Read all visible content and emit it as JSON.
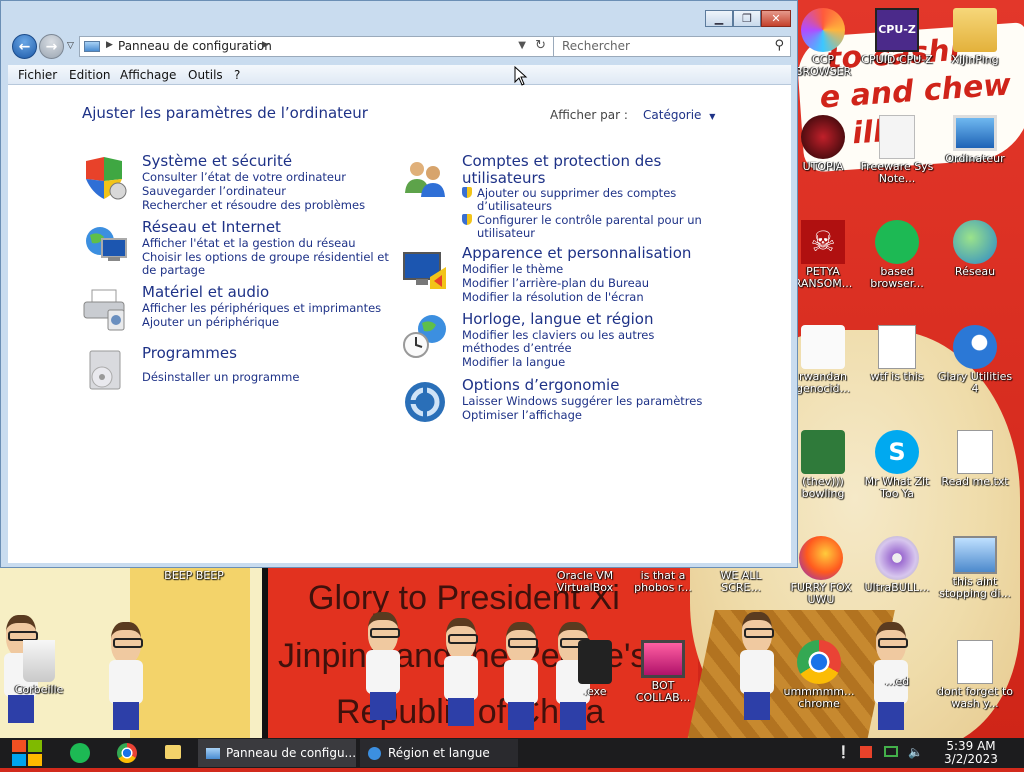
{
  "window": {
    "address_path": "Panneau de configuration",
    "search_placeholder": "Rechercher",
    "menu": [
      "Fichier",
      "Edition",
      "Affichage",
      "Outils",
      "?"
    ],
    "page_title": "Ajuster les paramètres de l’ordinateur",
    "view_by_label": "Afficher par :",
    "view_by_value": "Catégorie",
    "categories": [
      {
        "title": "Système et sécurité",
        "links": [
          "Consulter l’état de votre ordinateur",
          "Sauvegarder l’ordinateur",
          "Rechercher et résoudre des problèmes"
        ]
      },
      {
        "title": "Réseau et Internet",
        "links": [
          "Afficher l'état et la gestion du réseau",
          "Choisir les options de groupe résidentiel et de partage"
        ]
      },
      {
        "title": "Matériel et audio",
        "links": [
          "Afficher les périphériques et imprimantes",
          "Ajouter un périphérique"
        ]
      },
      {
        "title": "Programmes",
        "links": [
          "Désinstaller un programme"
        ]
      },
      {
        "title": "Comptes et protection des utilisateurs",
        "links": [
          "Ajouter ou supprimer des comptes d’utilisateurs",
          "Configurer le contrôle parental pour un utilisateur"
        ]
      },
      {
        "title": "Apparence et personnalisation",
        "links": [
          "Modifier le thème",
          "Modifier l’arrière-plan du Bureau",
          "Modifier la résolution de l'écran"
        ]
      },
      {
        "title": "Horloge, langue et région",
        "links": [
          "Modifier les claviers ou les autres méthodes d’entrée",
          "Modifier la langue"
        ]
      },
      {
        "title": "Options d’ergonomie",
        "links": [
          "Laisser Windows suggérer les paramètres",
          "Optimiser l’affichage"
        ]
      }
    ]
  },
  "desktop": {
    "banner_lines": [
      "to cashi",
      "e and chew",
      "illi"
    ],
    "poster_lines": [
      "Glory to President Xi",
      "Jinping and the People's",
      "Republic of China"
    ],
    "icons": [
      {
        "label": "CCP BROWSER"
      },
      {
        "label": "CPUID CPU-Z"
      },
      {
        "label": "XiJinPing"
      },
      {
        "label": "UTOPIA"
      },
      {
        "label": "Freeware Sys Note..."
      },
      {
        "label": "Ordinateur"
      },
      {
        "label": "PETYA RANSOM..."
      },
      {
        "label": "based browser..."
      },
      {
        "label": "Réseau"
      },
      {
        "label": "rwandan genocid..."
      },
      {
        "label": "wtf is this"
      },
      {
        "label": "Glary Utilities 4"
      },
      {
        "label": "(thev))) bowling"
      },
      {
        "label": "Mr What Zit Too Ya"
      },
      {
        "label": "Read me.txt"
      },
      {
        "label": "BEEP BEEP"
      },
      {
        "label": "Oracle VM VirtualBox"
      },
      {
        "label": "is that a phobos r..."
      },
      {
        "label": "WE ALL SCRE..."
      },
      {
        "label": "FURRY FOX UWU"
      },
      {
        "label": "UltraBULL..."
      },
      {
        "label": "this aint stopping di..."
      },
      {
        "label": "Corbeille"
      },
      {
        "label": ".exe"
      },
      {
        "label": "BOT COLLAB..."
      },
      {
        "label": "ummmmm... chrome"
      },
      {
        "label": "...ed"
      },
      {
        "label": "dont forget to wash y..."
      }
    ]
  },
  "taskbar": {
    "tasks": [
      "Panneau de configu...",
      "Région et langue"
    ],
    "time": "5:39 AM",
    "date": "3/2/2023"
  },
  "colors": {
    "link_blue": "#1e3287",
    "window_frame": "#c9dcef",
    "taskbar": "#1c1c1e",
    "desktop_red": "#d22a1c"
  }
}
